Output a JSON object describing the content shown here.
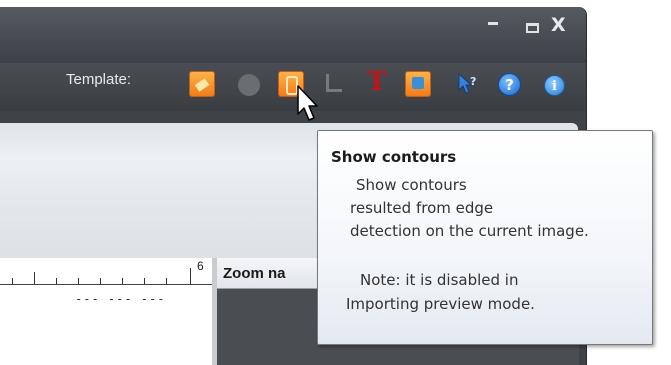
{
  "toolbar": {
    "template_label": "Template:"
  },
  "window_buttons": {
    "close": "X"
  },
  "toolbar_icons": {
    "text_tool": "T",
    "help": "?",
    "info": "i"
  },
  "ruler": {
    "end_value": "6",
    "dashes": "--- --- ---"
  },
  "zoom_panel": {
    "title": "Zoom na"
  },
  "tooltip": {
    "title": "Show contours",
    "lines": [
      "Show contours",
      "resulted from edge",
      "detection on the current image.",
      "Note: it is disabled in",
      "Importing preview mode."
    ]
  },
  "colors": {
    "window_bg": "#3f4247",
    "accent_orange": "#f07c1a",
    "text_tool_red": "#c01418",
    "help_blue": "#1864c8"
  }
}
